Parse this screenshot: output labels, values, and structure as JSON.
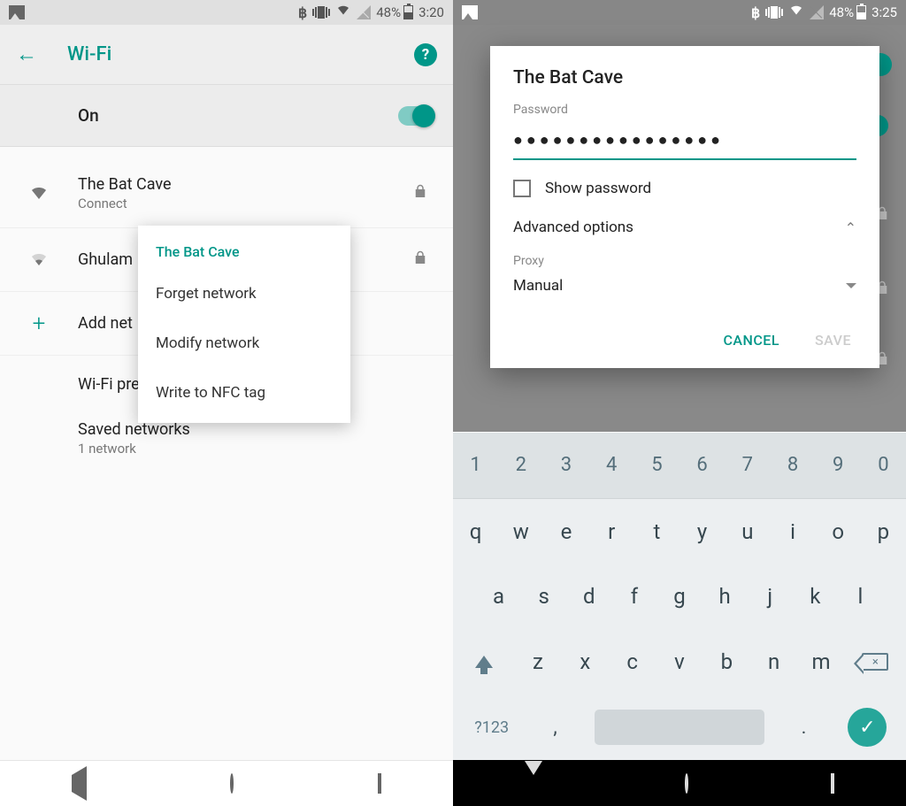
{
  "left": {
    "status": {
      "battery": "48%",
      "time": "3:20"
    },
    "appbar": {
      "title": "Wi-Fi"
    },
    "toggle": {
      "label": "On"
    },
    "networks": [
      {
        "name": "The Bat Cave",
        "sub": "Connect"
      },
      {
        "name": "Ghulam"
      }
    ],
    "add": "Add net",
    "prefs": "Wi-Fi preferences",
    "saved": {
      "label": "Saved networks",
      "sub": "1 network"
    },
    "menu": {
      "title": "The Bat Cave",
      "items": [
        "Forget network",
        "Modify network",
        "Write to NFC tag"
      ]
    }
  },
  "right": {
    "status": {
      "battery": "48%",
      "time": "3:25"
    },
    "dialog": {
      "title": "The Bat Cave",
      "password_label": "Password",
      "password_value": "●●●●●●●●●●●●●●●●",
      "show_pw": "Show password",
      "advanced": "Advanced options",
      "proxy_label": "Proxy",
      "proxy_value": "Manual",
      "cancel": "CANCEL",
      "save": "SAVE"
    },
    "keyboard": {
      "row1": [
        "1",
        "2",
        "3",
        "4",
        "5",
        "6",
        "7",
        "8",
        "9",
        "0"
      ],
      "row2": [
        "q",
        "w",
        "e",
        "r",
        "t",
        "y",
        "u",
        "i",
        "o",
        "p"
      ],
      "row3": [
        "a",
        "s",
        "d",
        "f",
        "g",
        "h",
        "j",
        "k",
        "l"
      ],
      "row4": [
        "z",
        "x",
        "c",
        "v",
        "b",
        "n",
        "m"
      ],
      "sym": "?123",
      "comma": ",",
      "dot": "."
    }
  }
}
